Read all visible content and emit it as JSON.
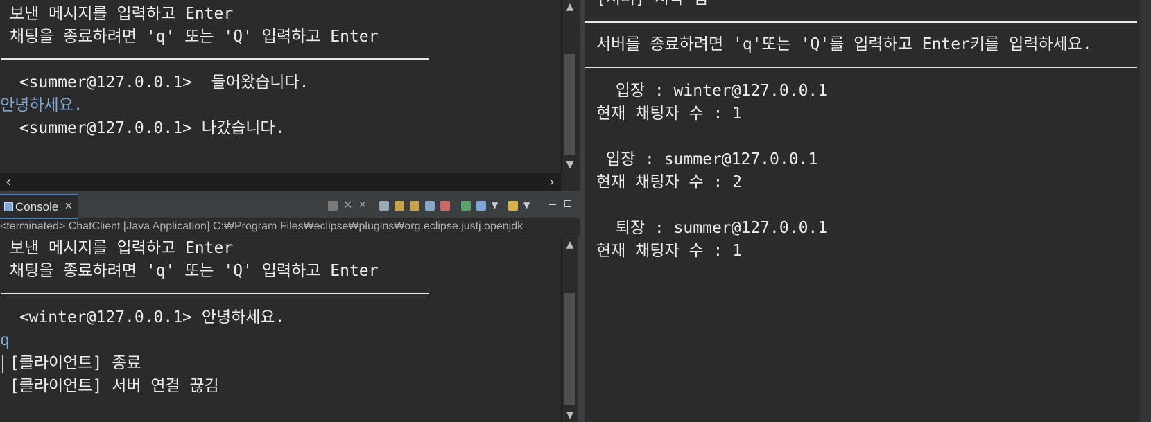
{
  "top_console": {
    "lines": [
      " 보낸 메시지를 입력하고 Enter",
      " 채팅을 종료하려면 'q' 또는 'Q' 입력하고 Enter",
      "  <summer@127.0.0.1>  들어왔습니다.",
      "안녕하세요.",
      "  <summer@127.0.0.1> 나갔습니다."
    ]
  },
  "console_view": {
    "tab_label": "Console",
    "close_glyph": "✕",
    "status_line": "<terminated> ChatClient [Java Application] C:₩Program Files₩eclipse₩plugins₩org.eclipse.justj.openjdk"
  },
  "bottom_console": {
    "lines": [
      " 보낸 메시지를 입력하고 Enter",
      " 채팅을 종료하려면 'q' 또는 'Q' 입력하고 Enter",
      "  <winter@127.0.0.1> 안녕하세요.",
      "q",
      " [클라이언트] 종료",
      " [클라이언트] 서버 연결 끊김"
    ]
  },
  "server_console": {
    "header_cut": "[서버] 시작 됨",
    "instruction": "서버를 종료하려면 'q'또는 'Q'를 입력하고 Enter키를 입력하세요.",
    "events": [
      "  입장 : winter@127.0.0.1",
      "현재 채팅자 수 : 1",
      " 입장 : summer@127.0.0.1",
      "현재 채팅자 수 : 2",
      "  퇴장 : summer@127.0.0.1",
      "현재 채팅자 수 : 1"
    ]
  },
  "colors": {
    "background": "#2b2b2b",
    "text": "#ececec",
    "input_echo": "#7fa8d8",
    "tab_accent": "#4a7fc0"
  }
}
